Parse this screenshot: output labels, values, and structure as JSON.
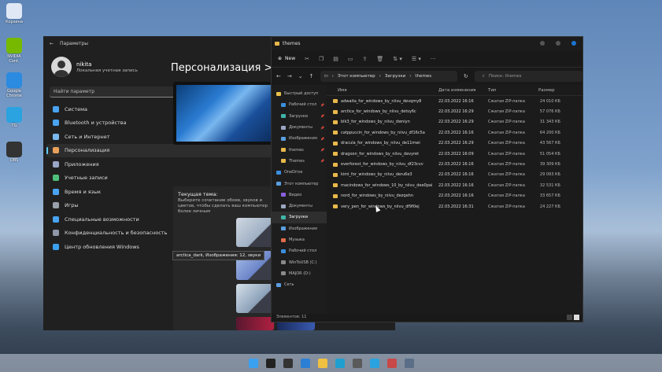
{
  "desktop": {
    "icons": [
      {
        "label": "Корзина",
        "icon": "recycle-bin-icon",
        "color": "#dfe8f4"
      },
      {
        "label": "NVIDIA Cont.",
        "icon": "nvidia-icon",
        "color": "#76b900"
      },
      {
        "label": "Google Chrome",
        "icon": "browser-icon",
        "color": "#2a8be0"
      },
      {
        "label": "TG",
        "icon": "telegram-icon",
        "color": "#2aa3e0"
      },
      {
        "label": "OBS",
        "icon": "obs-icon",
        "color": "#333333"
      }
    ]
  },
  "settings": {
    "title": "Параметры",
    "user_name": "nikita",
    "user_sub": "Локальная учетная запись",
    "search_placeholder": "Найти параметр",
    "nav": [
      {
        "label": "Система",
        "icon": "system-icon",
        "color": "#4aa3f0"
      },
      {
        "label": "Bluetooth и устройства",
        "icon": "bluetooth-icon",
        "color": "#4aa3f0"
      },
      {
        "label": "Сеть и Интернет",
        "icon": "network-icon",
        "color": "#7ab8ef"
      },
      {
        "label": "Персонализация",
        "icon": "brush-icon",
        "color": "#e8a05a"
      },
      {
        "label": "Приложения",
        "icon": "apps-icon",
        "color": "#9aa6c8"
      },
      {
        "label": "Учетные записи",
        "icon": "accounts-icon",
        "color": "#4fc07a"
      },
      {
        "label": "Время и язык",
        "icon": "time-language-icon",
        "color": "#4aa3f0"
      },
      {
        "label": "Игры",
        "icon": "gaming-icon",
        "color": "#9aa0aa"
      },
      {
        "label": "Специальные возможности",
        "icon": "accessibility-icon",
        "color": "#4aa3f0"
      },
      {
        "label": "Конфиденциальность и безопасность",
        "icon": "shield-icon",
        "color": "#8e98a8"
      },
      {
        "label": "Центр обновления Windows",
        "icon": "update-icon",
        "color": "#3aa0f0"
      }
    ],
    "selected_nav": 3,
    "heading": "Персонализация  >  Те",
    "current_theme_title": "Текущая тема:",
    "current_theme_desc": "Выберите сочетание обоев, звуков и цветов, чтобы сделать ваш компьютер более личным",
    "tooltip": "arctica_dark, Изображения: 12, звуки"
  },
  "explorer": {
    "title": "themes",
    "new_label": "New",
    "breadcrumb": [
      "Этот компьютер",
      "Загрузки",
      "themes"
    ],
    "search_placeholder": "Поиск: themes",
    "quick_access": "Быстрый доступ",
    "nav_items": [
      {
        "label": "Рабочий стол",
        "pinned": true,
        "color": "#3b8ede"
      },
      {
        "label": "Загрузки",
        "pinned": true,
        "color": "#3fb4a8"
      },
      {
        "label": "Документы",
        "pinned": true,
        "color": "#9aa6c0"
      },
      {
        "label": "Изображения",
        "pinned": true,
        "color": "#5a9ee0"
      },
      {
        "label": "themes",
        "pinned": true,
        "color": "#e8b84a"
      },
      {
        "label": "Themes",
        "pinned": true,
        "color": "#e8b84a"
      }
    ],
    "onedrive": "OneDrive",
    "this_pc": "Этот компьютер",
    "pc_items": [
      {
        "label": "Видео",
        "color": "#8b5ee0"
      },
      {
        "label": "Документы",
        "color": "#9aa6c0"
      },
      {
        "label": "Загрузки",
        "color": "#3fb4a8"
      },
      {
        "label": "Изображения",
        "color": "#5a9ee0"
      },
      {
        "label": "Музыка",
        "color": "#e06a4a"
      },
      {
        "label": "Рабочий стол",
        "color": "#3b8ede"
      },
      {
        "label": "WinToUSB (C:)",
        "color": "#8a8a8a"
      },
      {
        "label": "MAJOR (D:)",
        "color": "#8a8a8a"
      }
    ],
    "network": "Сеть",
    "columns": {
      "name": "Имя",
      "date": "Дата изменения",
      "type": "Тип",
      "size": "Размер"
    },
    "files": [
      {
        "name": "adwaita_for_windows_by_niivu_devqmy8",
        "date": "22.03.2022 16:16",
        "type": "Сжатая ZIP-папка",
        "size": "24 010 КБ"
      },
      {
        "name": "arctica_for_windows_by_niivu_detsy6c",
        "date": "22.03.2022 16:29",
        "type": "Сжатая ZIP-папка",
        "size": "57 076 КБ"
      },
      {
        "name": "blk3_for_windows_by_niivu_dwniyn",
        "date": "22.03.2022 16:29",
        "type": "Сжатая ZIP-папка",
        "size": "31 343 КБ"
      },
      {
        "name": "catppuccin_for_windows_by_niivu_df16c5a",
        "date": "22.03.2022 16:16",
        "type": "Сжатая ZIP-папка",
        "size": "64 200 КБ"
      },
      {
        "name": "dracula_for_windows_by_niivu_de11mwi",
        "date": "22.03.2022 16:29",
        "type": "Сжатая ZIP-папка",
        "size": "43 567 КБ"
      },
      {
        "name": "dragoon_for_windows_by_niivu_devyret",
        "date": "22.03.2022 16:09",
        "type": "Сжатая ZIP-папка",
        "size": "51 054 КБ"
      },
      {
        "name": "everforest_for_windows_by_niivu_df23cvv",
        "date": "22.03.2022 16:16",
        "type": "Сжатая ZIP-папка",
        "size": "39 309 КБ"
      },
      {
        "name": "kimi_for_windows_by_niivu_deru6e3",
        "date": "22.03.2022 16:16",
        "type": "Сжатая ZIP-папка",
        "size": "29 093 КБ"
      },
      {
        "name": "macindows_for_windows_10_by_niivu_dee0pai",
        "date": "22.03.2022 16:16",
        "type": "Сжатая ZIP-папка",
        "size": "32 531 КБ"
      },
      {
        "name": "nord_for_windows_by_niivu_dezqehn",
        "date": "22.03.2022 16:16",
        "type": "Сжатая ZIP-папка",
        "size": "33 657 КБ"
      },
      {
        "name": "very_pen_for_windows_by_niivu_df9f0ej",
        "date": "22.03.2022 16:31",
        "type": "Сжатая ZIP-папка",
        "size": "24 227 КБ"
      }
    ],
    "status": "Элементов: 11"
  },
  "taskbar": {
    "icons": [
      {
        "icon": "start-icon",
        "color": "#3aa0f0"
      },
      {
        "icon": "search-icon",
        "color": "#222222"
      },
      {
        "icon": "task-view-icon",
        "color": "#333333"
      },
      {
        "icon": "widgets-icon",
        "color": "#2b7fd4"
      },
      {
        "icon": "file-explorer-icon",
        "color": "#f0c040"
      },
      {
        "icon": "edge-icon",
        "color": "#1f9fd0"
      },
      {
        "icon": "store-icon",
        "color": "#5a5a5a"
      },
      {
        "icon": "telegram-icon",
        "color": "#2aa3e0"
      },
      {
        "icon": "app-icon",
        "color": "#c84848"
      },
      {
        "icon": "settings-icon",
        "color": "#5a6e88"
      }
    ]
  }
}
